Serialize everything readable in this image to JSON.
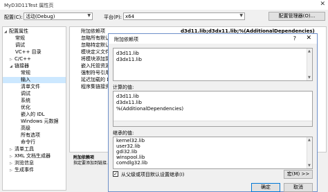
{
  "window": {
    "title": "MyD3D11Test 属性页",
    "close": "✕"
  },
  "header": {
    "config_label": "配置(C):",
    "config_value": "活动(Debug)",
    "platform_label": "平台(P):",
    "platform_value": "x64",
    "config_manager_button": "配置管理器(O)..."
  },
  "tree": {
    "items": [
      {
        "label": "配置属性",
        "expander": "◢"
      },
      {
        "label": "常规"
      },
      {
        "label": "调试"
      },
      {
        "label": "VC++ 目录"
      },
      {
        "label": "C/C++",
        "expander": "▷"
      },
      {
        "label": "链接器",
        "expander": "◢"
      },
      {
        "label": "常规"
      },
      {
        "label": "输入"
      },
      {
        "label": "清单文件"
      },
      {
        "label": "调试"
      },
      {
        "label": "系统"
      },
      {
        "label": "优化"
      },
      {
        "label": "嵌入的 IDL"
      },
      {
        "label": "Windows 元数据"
      },
      {
        "label": "高级"
      },
      {
        "label": "所有选项"
      },
      {
        "label": "命令行"
      },
      {
        "label": "清单工具",
        "expander": "▷"
      },
      {
        "label": "XML 文档生成器",
        "expander": "▷"
      },
      {
        "label": "浏览信息",
        "expander": "▷"
      },
      {
        "label": "生成事件",
        "expander": "▷"
      }
    ]
  },
  "grid": {
    "rows": [
      "附加依赖项",
      "忽略所有默认库",
      "忽略特定默认库",
      "模块定义文件",
      "将模块添加到程序集",
      "嵌入托管资源文件",
      "强制符号引用",
      "延迟加载的 DLL",
      "程序集链接资源"
    ],
    "selected_value": "d3d11.lib;d3dx11.lib;%(AdditionalDependencies)"
  },
  "description": {
    "title": "附加依赖项",
    "text": "指定要添加到链接..."
  },
  "dialog": {
    "title": "附加依赖项",
    "help": "?",
    "close": "✕",
    "edit_lines": [
      "d3d11.lib",
      "d3dx11.lib"
    ],
    "evaluated_label": "计算的值:",
    "evaluated_lines": [
      "d3d11.lib",
      "d3dx11.lib",
      "%(AdditionalDependencies)"
    ],
    "inherited_label": "继承的值:",
    "inherited_lines": [
      "kernel32.lib",
      "user32.lib",
      "gdi32.lib",
      "winspool.lib",
      "comdlg32.lib"
    ],
    "inherit_checkbox_label": "从父级或项目默认设置继承(I)",
    "inherit_checked": "✓",
    "macro_button": "宏(M) >>",
    "ok_button": "确定",
    "cancel_button": "取消"
  }
}
